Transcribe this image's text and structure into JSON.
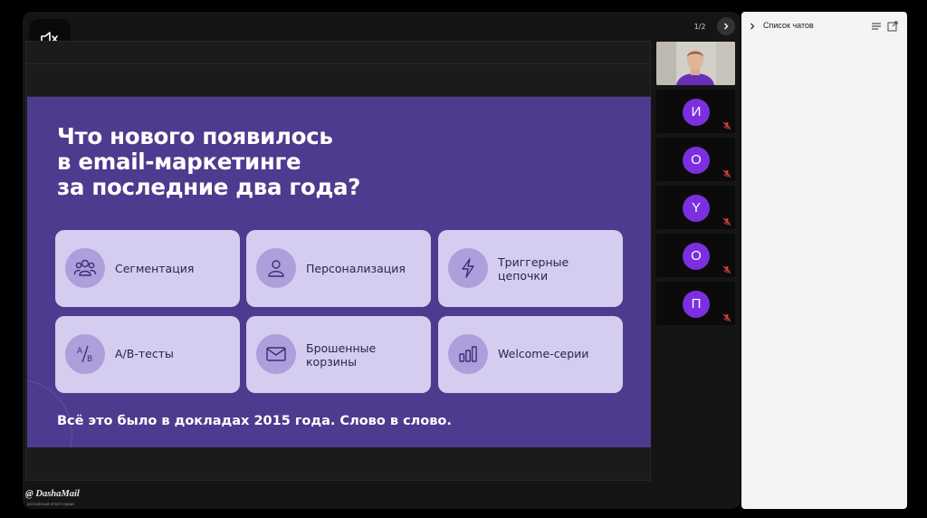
{
  "stage": {
    "page_counter": "1/2"
  },
  "slide": {
    "title_lines": [
      "Что нового появилось",
      "в email-маркетинге",
      "за последние два года?"
    ],
    "cards": [
      {
        "label": "Сегментация",
        "icon": "users-icon"
      },
      {
        "label": "Персонализация",
        "icon": "person-icon"
      },
      {
        "label": "Триггерные цепочки",
        "icon": "lightning-icon"
      },
      {
        "label": "A/B-тесты",
        "icon": "ab-icon"
      },
      {
        "label": "Брошенные корзины",
        "icon": "envelope-icon"
      },
      {
        "label": "Welcome-серии",
        "icon": "bar-chart-icon"
      }
    ],
    "footer": "Всё это было в докладах 2015 года. Слово в слово.",
    "colors": {
      "background": "#4e3a8e",
      "card": "#d4cdef",
      "icon_circle": "#ad9edc"
    }
  },
  "participants": [
    {
      "type": "video",
      "initial": ""
    },
    {
      "type": "avatar",
      "initial": "И"
    },
    {
      "type": "avatar",
      "initial": "О"
    },
    {
      "type": "avatar",
      "initial": "Y"
    },
    {
      "type": "avatar",
      "initial": "О"
    },
    {
      "type": "avatar",
      "initial": "П"
    }
  ],
  "avatar_color": "#7b2fe0",
  "chat": {
    "title": "Список чатов"
  },
  "logo": {
    "text": "@ DashaMail",
    "subtitle": "российский email-сервис"
  }
}
